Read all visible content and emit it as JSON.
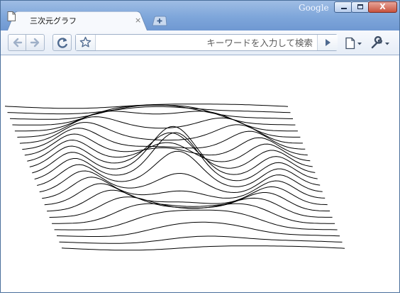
{
  "window": {
    "brand": "Google",
    "minimize_icon": "minimize-icon",
    "maximize_icon": "maximize-icon",
    "close_label": "X"
  },
  "tab": {
    "title": "三次元グラフ",
    "close_label": "×",
    "icon": "page-icon"
  },
  "toolbar": {
    "back_icon": "back-arrow-icon",
    "forward_icon": "forward-arrow-icon",
    "reload_icon": "reload-icon",
    "star_icon": "star-icon",
    "go_icon": "go-arrow-icon",
    "page_menu_icon": "page-menu-icon",
    "wrench_icon": "wrench-icon"
  },
  "omnibox": {
    "value": "",
    "placeholder": "キーワードを入力して検索"
  },
  "colors": {
    "titlebar": "#7ea6da",
    "close_button": "#c8533e",
    "line": "#000000"
  },
  "graph": {
    "rows": 24,
    "cols": 80,
    "description_label": ""
  }
}
